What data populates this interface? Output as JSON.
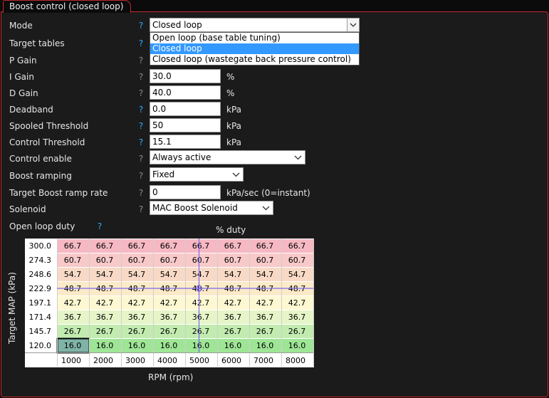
{
  "panel": {
    "title": "Boost control (closed loop)"
  },
  "form": {
    "mode": {
      "label": "Mode",
      "value": "Closed loop",
      "options": [
        "Open loop (base table tuning)",
        "Closed loop",
        "Closed loop (wastegate back pressure control)"
      ],
      "selected_index": 1
    },
    "target_tables": {
      "label": "Target tables"
    },
    "p_gain": {
      "label": "P Gain"
    },
    "i_gain": {
      "label": "I Gain",
      "value": "30.0",
      "unit": "%"
    },
    "d_gain": {
      "label": "D Gain",
      "value": "40.0",
      "unit": "%"
    },
    "deadband": {
      "label": "Deadband",
      "value": "0.0",
      "unit": "kPa"
    },
    "spooled_threshold": {
      "label": "Spooled Threshold",
      "value": "50",
      "unit": "kPa"
    },
    "control_threshold": {
      "label": "Control Threshold",
      "value": "15.1",
      "unit": "kPa"
    },
    "control_enable": {
      "label": "Control enable",
      "value": "Always active"
    },
    "boost_ramping": {
      "label": "Boost ramping",
      "value": "Fixed"
    },
    "ramp_rate": {
      "label": "Target Boost ramp rate",
      "value": "0",
      "unit": "kPa/sec (0=instant)"
    },
    "solenoid": {
      "label": "Solenoid",
      "value": "MAC Boost Solenoid"
    },
    "open_loop_duty": {
      "label": "Open loop duty"
    },
    "help_mark": "?"
  },
  "colors": {
    "border_accent": "#c0282e",
    "help_active": "#2fa8ff",
    "help_inactive": "#8a8a8a",
    "selection": "#3399ff",
    "crosshair": "#7b68ee"
  },
  "chart_data": {
    "type": "heatmap",
    "title": "% duty",
    "xlabel": "RPM (rpm)",
    "ylabel": "Target MAP (kPa)",
    "x": [
      "1000",
      "2000",
      "3000",
      "4000",
      "5000",
      "6000",
      "7000",
      "8000"
    ],
    "y": [
      "300.0",
      "274.3",
      "248.6",
      "222.9",
      "197.1",
      "171.4",
      "145.7",
      "120.0"
    ],
    "values": [
      [
        "66.7",
        "66.7",
        "66.7",
        "66.7",
        "66.7",
        "66.7",
        "66.7",
        "66.7"
      ],
      [
        "60.7",
        "60.7",
        "60.7",
        "60.7",
        "60.7",
        "60.7",
        "60.7",
        "60.7"
      ],
      [
        "54.7",
        "54.7",
        "54.7",
        "54.7",
        "54.7",
        "54.7",
        "54.7",
        "54.7"
      ],
      [
        "48.7",
        "48.7",
        "48.7",
        "48.7",
        "48.7",
        "48.7",
        "48.7",
        "48.7"
      ],
      [
        "42.7",
        "42.7",
        "42.7",
        "42.7",
        "42.7",
        "42.7",
        "42.7",
        "42.7"
      ],
      [
        "36.7",
        "36.7",
        "36.7",
        "36.7",
        "36.7",
        "36.7",
        "36.7",
        "36.7"
      ],
      [
        "26.7",
        "26.7",
        "26.7",
        "26.7",
        "26.7",
        "26.7",
        "26.7",
        "26.7"
      ],
      [
        "16.0",
        "16.0",
        "16.0",
        "16.0",
        "16.0",
        "16.0",
        "16.0",
        "16.0"
      ]
    ],
    "row_colors": [
      "#f6b8c3",
      "#f7c9c8",
      "#f8d9c6",
      "#fbeac7",
      "#fdf8d2",
      "#e6f5c8",
      "#c2ebb0",
      "#9ee596"
    ],
    "selected_cell": {
      "row": 7,
      "col": 0
    },
    "selected_color": "#7fb3a6",
    "operating_point": {
      "rpm": 5000,
      "map_kpa": 222.9
    }
  }
}
